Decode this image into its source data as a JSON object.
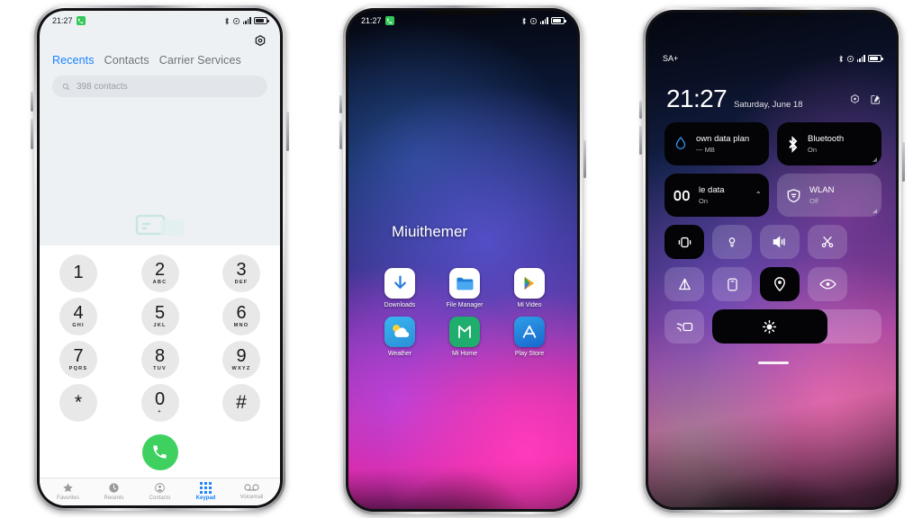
{
  "background_color": "#ffffff",
  "phone1": {
    "name": "dialer-phone",
    "status_bar": {
      "time": "21:27",
      "call_badge_icon": "phone-call-icon",
      "icons": [
        "bluetooth-icon",
        "alarm-icon",
        "signal-icon",
        "battery-icon"
      ]
    },
    "header": {
      "settings_icon": "gear-icon"
    },
    "tabs": [
      {
        "label": "Recents",
        "active": true
      },
      {
        "label": "Contacts",
        "active": false
      },
      {
        "label": "Carrier Services",
        "active": false
      }
    ],
    "search": {
      "icon": "search-icon",
      "placeholder": "398 contacts",
      "value": ""
    },
    "empty_illustration": "no-recent-calls-illustration",
    "keypad": [
      [
        {
          "num": "1",
          "sub": ""
        },
        {
          "num": "2",
          "sub": "ABC"
        },
        {
          "num": "3",
          "sub": "DEF"
        }
      ],
      [
        {
          "num": "4",
          "sub": "GHI"
        },
        {
          "num": "5",
          "sub": "JKL"
        },
        {
          "num": "6",
          "sub": "MNO"
        }
      ],
      [
        {
          "num": "7",
          "sub": "PQRS"
        },
        {
          "num": "8",
          "sub": "TUV"
        },
        {
          "num": "9",
          "sub": "WXYZ"
        }
      ],
      [
        {
          "num": "*",
          "sub": ""
        },
        {
          "num": "0",
          "sub": "+"
        },
        {
          "num": "#",
          "sub": ""
        }
      ]
    ],
    "call_button": {
      "icon": "phone-handset-icon",
      "color": "#3ed160"
    },
    "tabbar": [
      {
        "label": "Favorites",
        "icon": "star-icon",
        "active": false
      },
      {
        "label": "Recents",
        "icon": "clock-icon",
        "active": false
      },
      {
        "label": "Contacts",
        "icon": "person-circle-icon",
        "active": false
      },
      {
        "label": "Keypad",
        "icon": "keypad-grid-icon",
        "active": true
      },
      {
        "label": "Voicemail",
        "icon": "voicemail-icon",
        "active": false
      }
    ],
    "accent_color": "#1a82ff"
  },
  "phone2": {
    "name": "home-screen-phone",
    "status_bar": {
      "time": "21:27",
      "call_badge_icon": "phone-call-icon",
      "icons": [
        "bluetooth-icon",
        "alarm-icon",
        "signal-icon",
        "battery-icon"
      ]
    },
    "wallpaper": "nebula-purple-magenta",
    "title": "Miuithemer",
    "apps": [
      [
        {
          "label": "Downloads",
          "icon": "download-arrow-icon",
          "bg": "#ffffff"
        },
        {
          "label": "File Manager",
          "icon": "folder-icon",
          "bg": "#ffffff"
        },
        {
          "label": "Mi Video",
          "icon": "play-triangle-icon",
          "bg": "#ffffff"
        }
      ],
      [
        {
          "label": "Weather",
          "icon": "sun-cloud-icon",
          "bg": "#2fa8e8"
        },
        {
          "label": "Mi Home",
          "icon": "mi-logo-icon",
          "bg": "#1fae6d"
        },
        {
          "label": "Play Store",
          "icon": "appstore-a-icon",
          "bg": "#1f86e0"
        }
      ]
    ]
  },
  "phone3": {
    "name": "control-center-phone",
    "status_bar": {
      "carrier": "SA+",
      "icons": [
        "bluetooth-icon",
        "alarm-icon",
        "signal-icon",
        "battery-icon"
      ]
    },
    "clock": {
      "time": "21:27",
      "date": "Saturday, June 18"
    },
    "header_actions": [
      {
        "name": "settings-icon"
      },
      {
        "name": "edit-icon"
      }
    ],
    "tiles": [
      [
        {
          "title": "own data plan",
          "subtitle": "--- MB",
          "icon": "water-drop-icon",
          "state": "dark"
        },
        {
          "title": "Bluetooth",
          "subtitle": "On",
          "icon": "bluetooth-icon",
          "state": "dark"
        }
      ],
      [
        {
          "title": "le data",
          "subtitle": "On",
          "icon": "mobile-data-icon",
          "state": "dark"
        },
        {
          "title": "WLAN",
          "subtitle": "Off",
          "icon": "wlan-shield-icon",
          "state": "glass"
        }
      ]
    ],
    "toggles_row1": [
      {
        "name": "vibrate-icon",
        "active": true
      },
      {
        "name": "flashlight-icon",
        "active": false
      },
      {
        "name": "volume-icon",
        "active": false
      },
      {
        "name": "scissors-screenshot-icon",
        "active": false
      }
    ],
    "toggles_row2": [
      {
        "name": "airplane-icon",
        "active": false
      },
      {
        "name": "screen-rotation-icon",
        "active": false
      },
      {
        "name": "location-icon",
        "active": true
      },
      {
        "name": "eye-reading-mode-icon",
        "active": false
      }
    ],
    "toggles_row3": [
      {
        "name": "cast-icon",
        "active": false
      }
    ],
    "brightness": {
      "name": "brightness-slider",
      "icon": "brightness-sun-icon",
      "percent": 68
    },
    "drag_handle": "drag-handle"
  }
}
